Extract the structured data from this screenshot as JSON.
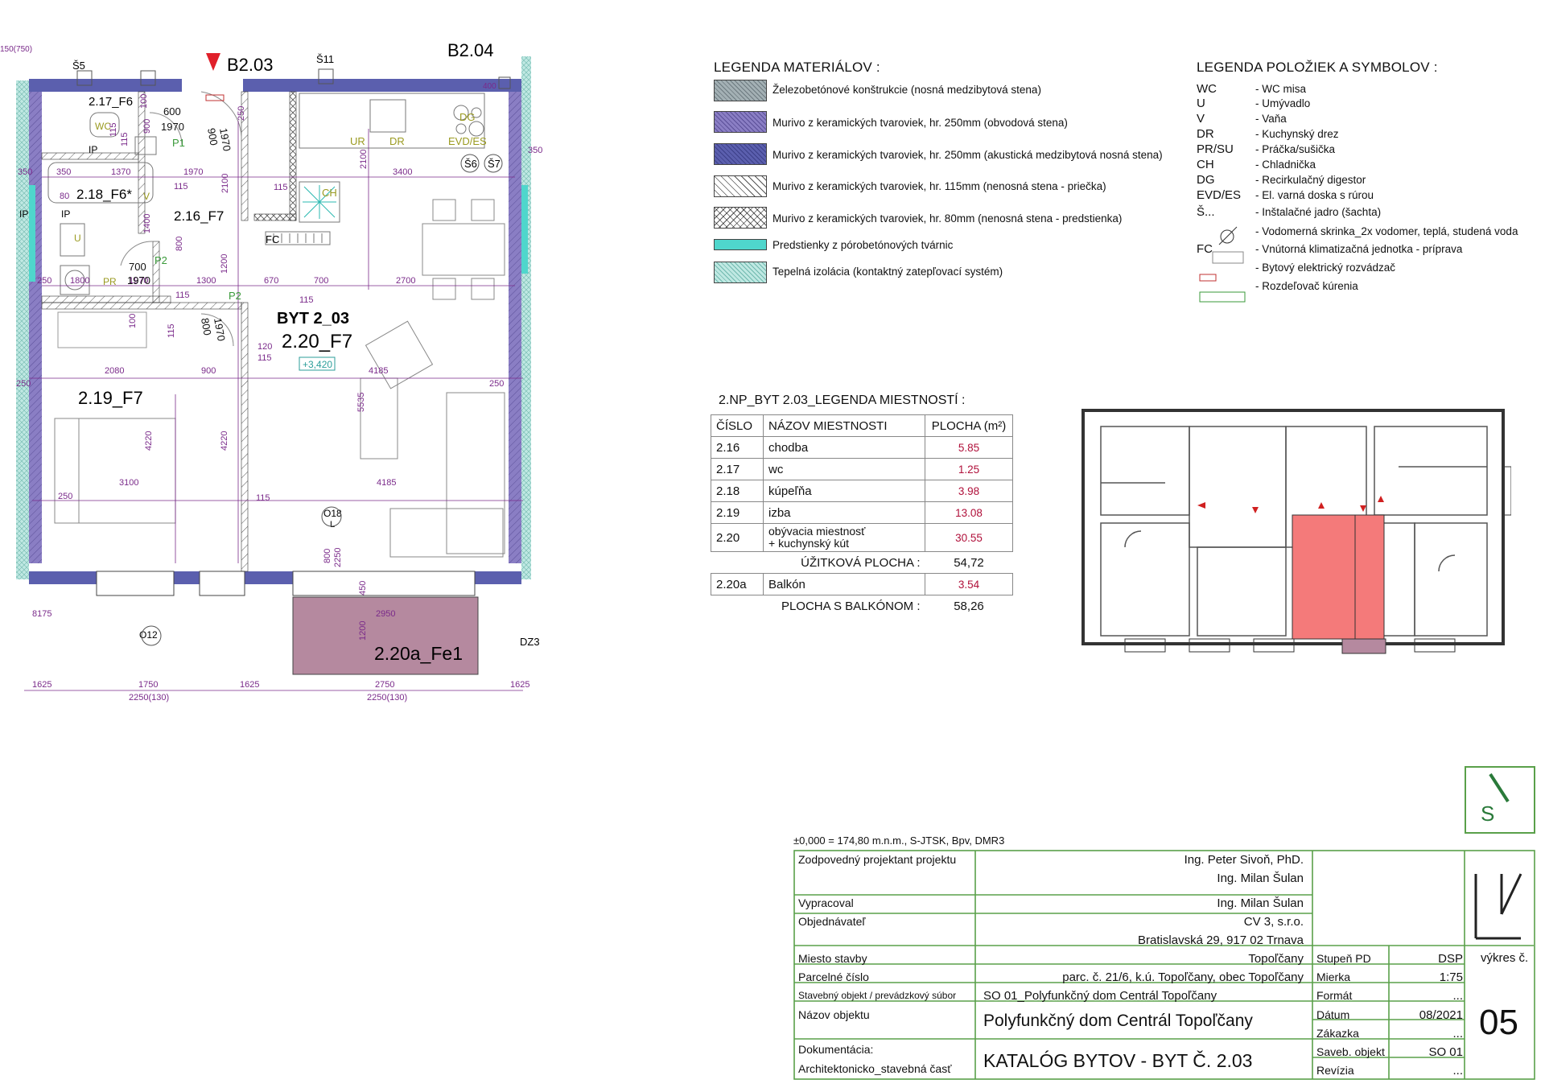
{
  "plan": {
    "unit_labels": {
      "byt": "BYT 2_03",
      "main_room": "2.20_F7",
      "level": "+3,420"
    },
    "room_labels": [
      "2.17_F6",
      "2.18_F6*",
      "2.16_F7",
      "2.19_F7",
      "2.20a_Fe1",
      "B2.03",
      "B2.04"
    ],
    "shaft_labels": [
      "Š5",
      "Š11",
      "Š6",
      "Š7",
      "O18",
      "O12",
      "DZ3",
      "L"
    ],
    "fixture_labels": [
      "WC",
      "IP",
      "IP",
      "V",
      "U",
      "PR",
      "UR",
      "DR",
      "DG",
      "EVD/ES",
      "CH",
      "FC",
      "P1",
      "P2",
      "P2",
      "IP"
    ],
    "dimensions": [
      "1970",
      "3400",
      "2100",
      "2100",
      "1370",
      "1970",
      "350",
      "350",
      "350",
      "80",
      "1300",
      "670",
      "700",
      "2700",
      "1800",
      "250",
      "115",
      "115",
      "115",
      "115",
      "115",
      "115",
      "115",
      "120",
      "2080",
      "900",
      "4185",
      "4185",
      "250",
      "250",
      "250",
      "5535",
      "4220",
      "4220",
      "3100",
      "2950",
      "1200",
      "800",
      "2250",
      "450",
      "8175",
      "1625",
      "1750",
      "1625",
      "2750",
      "1625",
      "2250(130)",
      "2250(130)",
      "600",
      "1970",
      "900",
      "1970",
      "250",
      "400",
      "100",
      "900",
      "115",
      "1400",
      "800",
      "700",
      "1970",
      "1200",
      "800",
      "1970",
      "100",
      "115",
      "150(750)"
    ]
  },
  "legend_materials": {
    "title": "LEGENDA MATERIÁLOV :",
    "items": [
      {
        "label": "Železobetónové konštrukcie (nosná medzibytová stena)",
        "color": "#8fa0a6"
      },
      {
        "label": "Murivo z keramických tvaroviek, hr. 250mm (obvodová stena)",
        "color": "#8a7ec4"
      },
      {
        "label": "Murivo z keramických tvaroviek, hr. 250mm (akustická medzibytová nosná stena)",
        "color": "#5b5fae"
      },
      {
        "label": "Murivo z keramických tvaroviek, hr. 115mm (nenosná stena - priečka)",
        "color": "#ffffff"
      },
      {
        "label": "Murivo z keramických tvaroviek, hr.   80mm (nenosná stena - predstienka)",
        "color": "#ffffff"
      },
      {
        "label": "Predstienky z pórobetónových tvárnic",
        "color": "#4fd6cc"
      },
      {
        "label": "Tepelná izolácia (kontaktný zatepľovací systém)",
        "color": "#a8e0d8"
      }
    ]
  },
  "legend_symbols": {
    "title": "LEGENDA POLOŽIEK A SYMBOLOV :",
    "items": [
      {
        "code": "WC",
        "label": "- WC misa"
      },
      {
        "code": "U",
        "label": "- Umývadlo"
      },
      {
        "code": "V",
        "label": "- Vaňa"
      },
      {
        "code": "DR",
        "label": "- Kuchynský drez"
      },
      {
        "code": "PR/SU",
        "label": "- Práčka/sušička"
      },
      {
        "code": "CH",
        "label": "- Chladnička"
      },
      {
        "code": "DG",
        "label": "- Recirkulačný digestor"
      },
      {
        "code": "EVD/ES",
        "label": "- El. varná doska s rúrou"
      },
      {
        "code": "Š...",
        "label": "- Inštalačné jadro (šachta)"
      },
      {
        "code": "",
        "label": "- Vodomerná skrinka_2x vodomer, teplá, studená voda"
      },
      {
        "code": "FC",
        "label": "- Vnútorná klimatizačná jednotka - príprava"
      },
      {
        "code": "",
        "label": "- Bytový elektrický rozvádzač"
      },
      {
        "code": "",
        "label": "- Rozdeľovač kúrenia"
      }
    ]
  },
  "room_table": {
    "title": "2.NP_BYT 2.03_LEGENDA MIESTNOSTÍ :",
    "headers": [
      "ČÍSLO",
      "NÁZOV MIESTNOSTI",
      "PLOCHA (m²)"
    ],
    "rows": [
      {
        "num": "2.16",
        "name": "chodba",
        "area": "5.85"
      },
      {
        "num": "2.17",
        "name": "wc",
        "area": "1.25"
      },
      {
        "num": "2.18",
        "name": "kúpeľňa",
        "area": "3.98"
      },
      {
        "num": "2.19",
        "name": "izba",
        "area": "13.08"
      },
      {
        "num": "2.20",
        "name": "obývacia miestnosť\n+ kuchynský kút",
        "area": "30.55"
      }
    ],
    "usable_label": "ÚŽITKOVÁ PLOCHA :",
    "usable_value": "54,72",
    "balcony": {
      "num": "2.20a",
      "name": "Balkón",
      "area": "3.54"
    },
    "with_balcony_label": "PLOCHA S BALKÓNOM :",
    "with_balcony_value": "58,26"
  },
  "title_block": {
    "elevation": "±0,000 = 174,80 m.n.m., S-JTSK, Bpv, DMR3",
    "rows": [
      {
        "label": "Zodpovedný projektant projektu",
        "value": "Ing. Peter Sivoň, PhD."
      },
      {
        "label": "",
        "value": "Ing. Milan Šulan"
      },
      {
        "label": "Vypracoval",
        "value": "Ing. Milan Šulan"
      },
      {
        "label": "Objednávateľ",
        "value": "CV 3, s.r.o."
      },
      {
        "label": "",
        "value": "Bratislavská 29, 917 02 Trnava"
      },
      {
        "label": "Miesto stavby",
        "value": "Topoľčany"
      },
      {
        "label": "Parcelné číslo",
        "value": "parc. č.  21/6, k.ú.  Topoľčany,  obec Topoľčany"
      },
      {
        "label": "Stavebný objekt / prevádzkový súbor",
        "value": "SO 01_Polyfunkčný dom Centrál Topoľčany"
      },
      {
        "label": "Názov objektu",
        "value": "Polyfunkčný dom Centrál Topoľčany"
      },
      {
        "label": "Dokumentácia:",
        "value": ""
      },
      {
        "label": "Architektonicko_stavebná časť",
        "value": "KATALÓG BYTOV - BYT Č. 2.03"
      }
    ],
    "meta": [
      {
        "label": "Stupeň PD",
        "value": "DSP"
      },
      {
        "label": "Mierka",
        "value": "1:75"
      },
      {
        "label": "Formát",
        "value": "..."
      },
      {
        "label": "Dátum",
        "value": "08/2021"
      },
      {
        "label": "Zákazka",
        "value": "..."
      },
      {
        "label": "Saveb. objekt",
        "value": "SO 01"
      },
      {
        "label": "Revízia",
        "value": "..."
      }
    ],
    "drawing_label": "výkres č.",
    "drawing_number": "05",
    "logo_letter": "S"
  },
  "colors": {
    "wall_outer": "#8a7ec4",
    "wall_acoustic": "#5b5fae",
    "dim": "#7a2a8a",
    "highlight": "#f47a7a",
    "balcony": "#b5899f",
    "frame": "#5aa04a"
  }
}
